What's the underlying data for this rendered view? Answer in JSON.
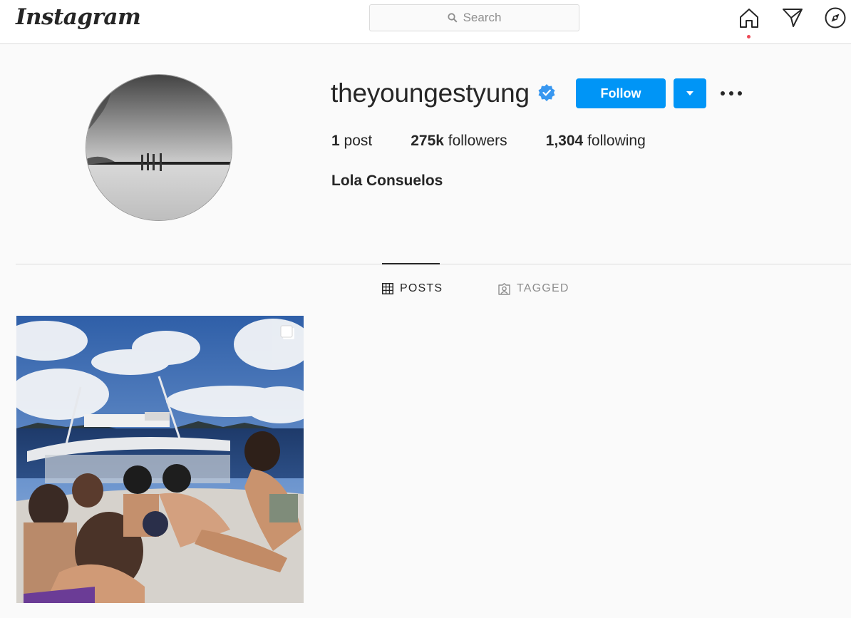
{
  "nav": {
    "logo": "Instagram",
    "search_placeholder": "Search",
    "icons": [
      "home-icon",
      "direct-icon",
      "explore-icon"
    ]
  },
  "profile": {
    "username": "theyoungestyung",
    "verified": true,
    "follow_label": "Follow",
    "stats": {
      "posts_count": "1",
      "posts_label": "post",
      "followers_count": "275k",
      "followers_label": "followers",
      "following_count": "1,304",
      "following_label": "following"
    },
    "full_name": "Lola Consuelos"
  },
  "tabs": [
    {
      "label": "POSTS",
      "active": true
    },
    {
      "label": "TAGGED",
      "active": false
    }
  ],
  "colors": {
    "accent": "#0095f6",
    "notification": "#ed4956"
  }
}
